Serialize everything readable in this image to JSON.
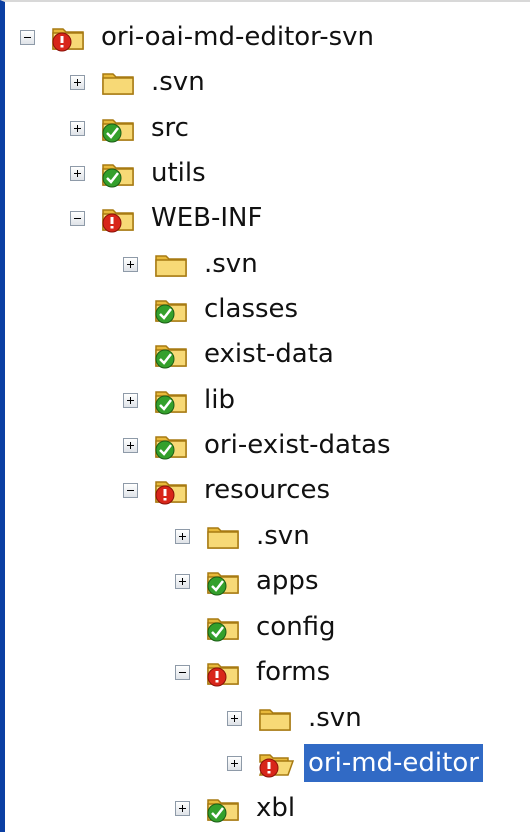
{
  "tree": {
    "items": [
      {
        "label": "ori-oai-md-editor-svn",
        "status": "conflict",
        "expander": "expanded",
        "selected": false
      },
      {
        "label": ".svn",
        "status": "plain",
        "expander": "collapsed",
        "selected": false
      },
      {
        "label": "src",
        "status": "normal",
        "expander": "collapsed",
        "selected": false
      },
      {
        "label": "utils",
        "status": "normal",
        "expander": "collapsed",
        "selected": false
      },
      {
        "label": "WEB-INF",
        "status": "conflict",
        "expander": "expanded",
        "selected": false
      },
      {
        "label": ".svn",
        "status": "plain",
        "expander": "collapsed",
        "selected": false
      },
      {
        "label": "classes",
        "status": "normal",
        "expander": "none",
        "selected": false
      },
      {
        "label": "exist-data",
        "status": "normal",
        "expander": "none",
        "selected": false
      },
      {
        "label": "lib",
        "status": "normal",
        "expander": "collapsed",
        "selected": false
      },
      {
        "label": "ori-exist-datas",
        "status": "normal",
        "expander": "collapsed",
        "selected": false
      },
      {
        "label": "resources",
        "status": "conflict",
        "expander": "expanded",
        "selected": false
      },
      {
        "label": ".svn",
        "status": "plain",
        "expander": "collapsed",
        "selected": false
      },
      {
        "label": "apps",
        "status": "normal",
        "expander": "collapsed",
        "selected": false
      },
      {
        "label": "config",
        "status": "normal",
        "expander": "none",
        "selected": false
      },
      {
        "label": "forms",
        "status": "conflict",
        "expander": "expanded",
        "selected": false
      },
      {
        "label": ".svn",
        "status": "plain",
        "expander": "collapsed",
        "selected": false
      },
      {
        "label": "ori-md-editor",
        "status": "conflict-open",
        "expander": "collapsed",
        "selected": true
      },
      {
        "label": "xbl",
        "status": "normal",
        "expander": "collapsed",
        "selected": false
      }
    ]
  },
  "colors": {
    "selection": "#316ac5",
    "folder": "#f2cf55",
    "status_normal": "#34a02c",
    "status_conflict": "#d8261a"
  }
}
